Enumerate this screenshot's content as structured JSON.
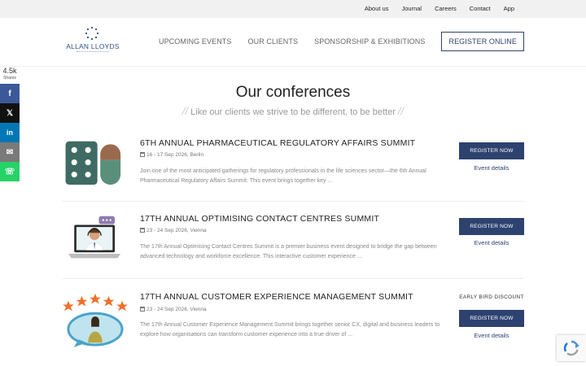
{
  "topnav": [
    "About us",
    "Journal",
    "Careers",
    "Contact",
    "App"
  ],
  "logo": {
    "text": "ALLAN LLOYDS"
  },
  "mainnav": {
    "items": [
      "UPCOMING EVENTS",
      "OUR CLIENTS",
      "SPONSORSHIP & EXHIBITIONS"
    ],
    "register": "REGISTER ONLINE"
  },
  "share": {
    "count": "4.5k",
    "label": "Shares",
    "buttons": [
      {
        "icon": "facebook-icon",
        "glyph": "f",
        "color": "#3b5998"
      },
      {
        "icon": "x-icon",
        "glyph": "𝕏",
        "color": "#111111"
      },
      {
        "icon": "linkedin-icon",
        "glyph": "in",
        "color": "#0077b5"
      },
      {
        "icon": "email-icon",
        "glyph": "✉",
        "color": "#7a7a7a"
      },
      {
        "icon": "whatsapp-icon",
        "glyph": "☏",
        "color": "#25d366"
      }
    ]
  },
  "heading": {
    "title": "Our conferences",
    "subtitle": "Like our clients we strive to be different, to be better"
  },
  "events": [
    {
      "title": "6TH ANNUAL PHARMACEUTICAL REGULATORY AFFAIRS SUMMIT",
      "date": "16 - 17 Sep 2026, Berlin",
      "description": "Join one of the most anticipated gatherings for regulatory professionals in the life sciences sector—the 6th Annual Pharmaceutical Regulatory Affairs Summit. This event brings together key ...",
      "badge": "",
      "register": "REGISTER NOW",
      "details": "Event details"
    },
    {
      "title": "17TH ANNUAL OPTIMISING CONTACT CENTRES SUMMIT",
      "date": "23 - 24 Sep 2026, Vienna",
      "description": "The 17th Annual Optimising Contact Centres Summit is a premier business event designed to bridge the gap between advanced technology and workforce excellence. This interactive customer experience ...",
      "badge": "",
      "register": "REGISTER NOW",
      "details": "Event details"
    },
    {
      "title": "17TH ANNUAL CUSTOMER EXPERIENCE MANAGEMENT SUMMIT",
      "date": "23 - 24 Sep 2026, Vienna",
      "description": "The 17th Annual Customer Experience Management Summit brings together senior CX, digital and business leaders to explore how organisations can transform customer experience into a true driver of ...",
      "badge": "EARLY BIRD DISCOUNT",
      "register": "REGISTER NOW",
      "details": "Event details"
    }
  ],
  "colors": {
    "brand": "#2e4270",
    "logo": "#2f4f86"
  }
}
